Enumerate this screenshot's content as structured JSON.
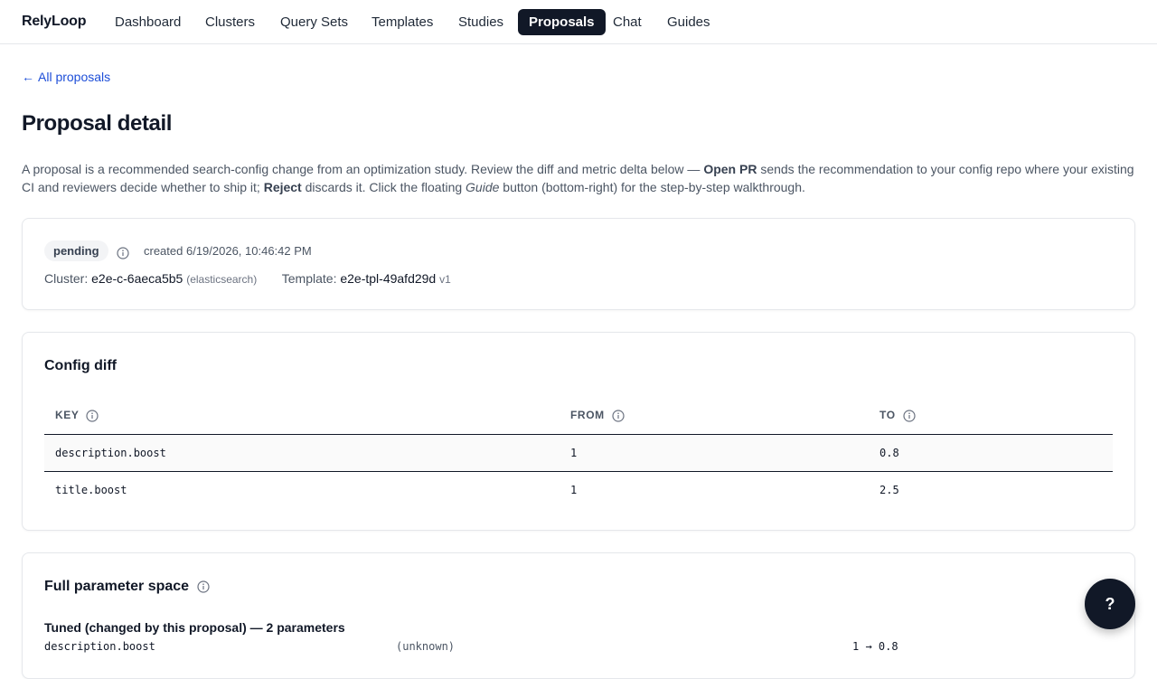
{
  "nav": {
    "brand": "RelyLoop",
    "items": [
      {
        "label": "Dashboard"
      },
      {
        "label": "Clusters"
      },
      {
        "label": "Query Sets"
      },
      {
        "label": "Templates"
      },
      {
        "label": "Studies"
      },
      {
        "label": "Proposals",
        "active": true
      },
      {
        "label": "Chat"
      },
      {
        "label": "Guides"
      }
    ]
  },
  "back_link": {
    "arrow": "←",
    "label": "All proposals"
  },
  "page_title": "Proposal detail",
  "intro": {
    "part1": "A proposal is a recommended search-config change from an optimization study. Review the diff and metric delta below — ",
    "open_pr": "Open PR",
    "part2": " sends the recommendation to your config repo where your existing CI and reviewers decide whether to ship it; ",
    "reject": "Reject",
    "part3": " discards it. Click the floating ",
    "guide": "Guide",
    "part4": " button (bottom-right) for the step-by-step walkthrough."
  },
  "summary": {
    "status": "pending",
    "created": "created 6/19/2026, 10:46:42 PM",
    "cluster_label": "Cluster:",
    "cluster_value": "e2e-c-6aeca5b5",
    "cluster_engine": "(elasticsearch)",
    "template_label": "Template:",
    "template_value": "e2e-tpl-49afd29d",
    "template_version": "v1"
  },
  "config_diff": {
    "title": "Config diff",
    "columns": {
      "key": "KEY",
      "from": "FROM",
      "to": "TO"
    },
    "rows": [
      {
        "key": "description.boost",
        "from": "1",
        "to": "0.8"
      },
      {
        "key": "title.boost",
        "from": "1",
        "to": "2.5"
      }
    ]
  },
  "param_space": {
    "title": "Full parameter space",
    "tuned_heading": "Tuned (changed by this proposal) — 2 parameters",
    "rows": [
      {
        "name": "description.boost",
        "type": "(unknown)",
        "change": "1 → 0.8"
      }
    ]
  },
  "help_button": {
    "label": "?"
  },
  "colors": {
    "accent": "#111827",
    "link": "#1d4ed8",
    "muted": "#4b5563"
  }
}
